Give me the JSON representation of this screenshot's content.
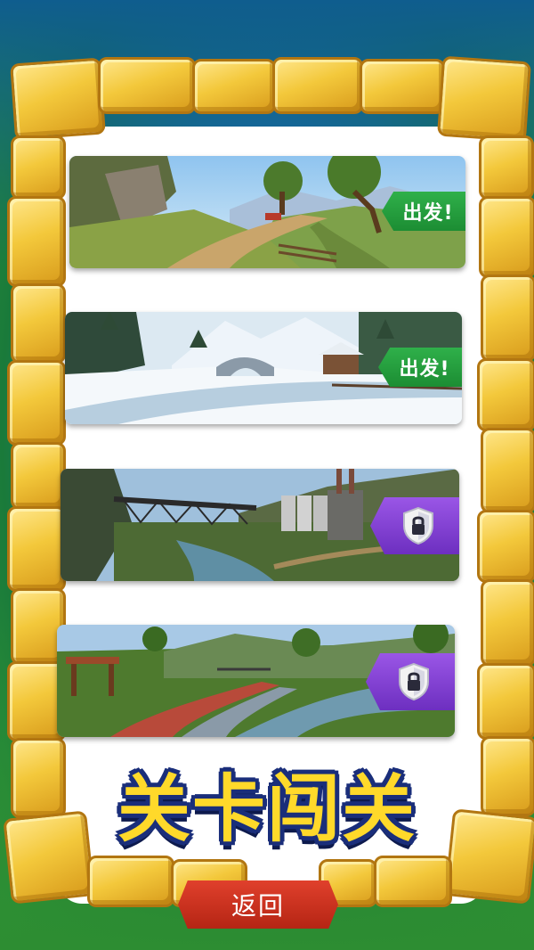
{
  "levels": [
    {
      "id": "mountain-road",
      "status": "unlocked",
      "action_label": "出发!"
    },
    {
      "id": "snow-bridge",
      "status": "unlocked",
      "action_label": "出发!"
    },
    {
      "id": "industrial-bridge",
      "status": "locked",
      "icon": "lock-shield-icon"
    },
    {
      "id": "river-path",
      "status": "locked",
      "icon": "lock-shield-icon"
    }
  ],
  "title": "关卡闯关",
  "back_label": "返回",
  "colors": {
    "go_button": "#1c8d33",
    "lock_button": "#7d3bd0",
    "back_button": "#c92f1c",
    "title_fill": "#ffd92a",
    "title_outline": "#1a2e7a",
    "stone": "#f3c83b"
  }
}
